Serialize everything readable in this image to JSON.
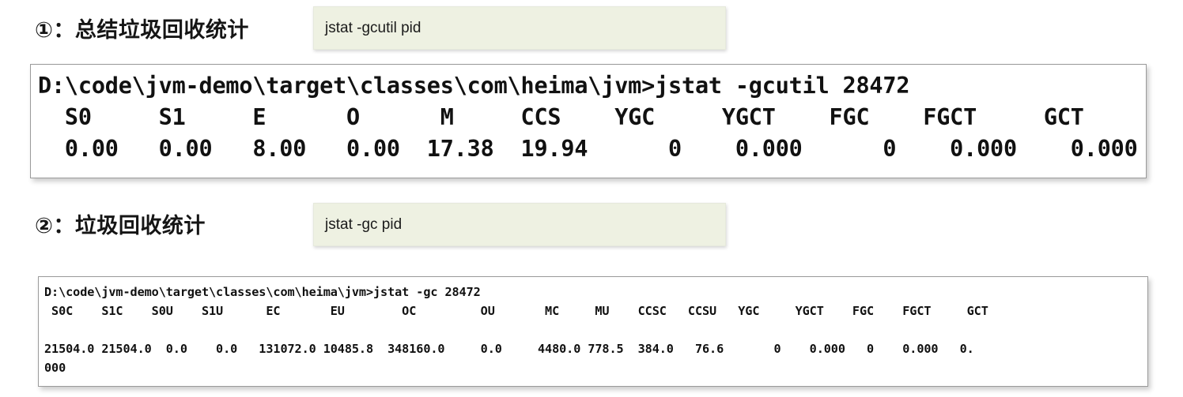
{
  "page": {
    "background_color": "#ffffff",
    "chip_color": "#eef1e2",
    "text_color": "#1a1a1a"
  },
  "sections": [
    {
      "marker": "①",
      "heading": "①：总结垃圾回收统计",
      "command_chip": "jstat -gcutil pid",
      "terminal": {
        "prompt_line": "D:\\code\\jvm-demo\\target\\classes\\com\\heima\\jvm>jstat -gcutil 28472",
        "header_line": "  S0     S1     E      O      M     CCS    YGC     YGCT    FGC    FGCT     GCT",
        "data_line": "  0.00   0.00   8.00   0.00  17.38  19.94      0    0.000      0    0.000    0.000",
        "columns": [
          "S0",
          "S1",
          "E",
          "O",
          "M",
          "CCS",
          "YGC",
          "YGCT",
          "FGC",
          "FGCT",
          "GCT"
        ],
        "values": [
          "0.00",
          "0.00",
          "8.00",
          "0.00",
          "17.38",
          "19.94",
          "0",
          "0.000",
          "0",
          "0.000",
          "0.000"
        ]
      }
    },
    {
      "marker": "②",
      "heading": "②：垃圾回收统计",
      "command_chip": "jstat -gc pid",
      "terminal": {
        "prompt_line": "D:\\code\\jvm-demo\\target\\classes\\com\\heima\\jvm>jstat -gc 28472",
        "header_line": " S0C    S1C    S0U    S1U      EC       EU        OC         OU       MC     MU    CCSC   CCSU   YGC     YGCT    FGC    FGCT     GCT",
        "data_line": "21504.0 21504.0  0.0    0.0   131072.0 10485.8  348160.0     0.0     4480.0 778.5  384.0   76.6       0    0.000   0    0.000   0.",
        "wrap_line": "000",
        "columns": [
          "S0C",
          "S1C",
          "S0U",
          "S1U",
          "EC",
          "EU",
          "OC",
          "OU",
          "MC",
          "MU",
          "CCSC",
          "CCSU",
          "YGC",
          "YGCT",
          "FGC",
          "FGCT",
          "GCT"
        ],
        "values": [
          "21504.0",
          "21504.0",
          "0.0",
          "0.0",
          "131072.0",
          "10485.8",
          "348160.0",
          "0.0",
          "4480.0",
          "778.5",
          "384.0",
          "76.6",
          "0",
          "0.000",
          "0",
          "0.000",
          "0.000"
        ]
      }
    }
  ]
}
